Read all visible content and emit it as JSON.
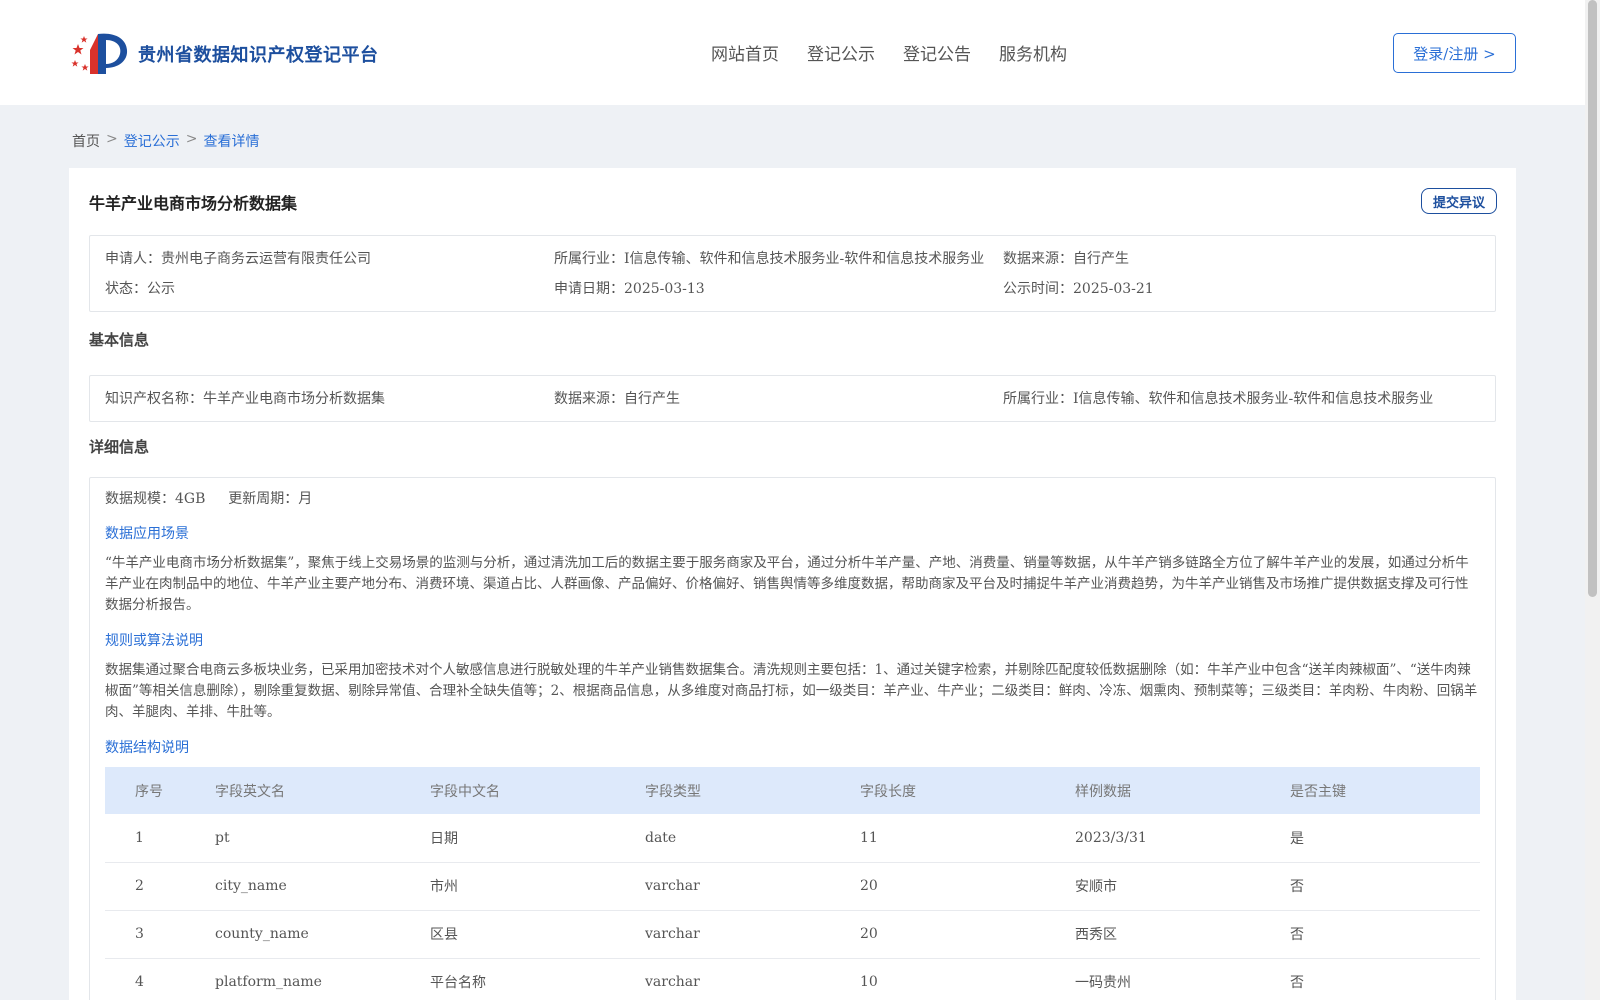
{
  "header": {
    "logo_text": "贵州省数据知识产权登记平台",
    "nav": [
      "网站首页",
      "登记公示",
      "登记公告",
      "服务机构"
    ],
    "login_label": "登录/注册 >"
  },
  "breadcrumb": {
    "home": "首页",
    "list": "登记公示",
    "current": "查看详情",
    "sep": ">"
  },
  "record": {
    "title": "牛羊产业电商市场分析数据集",
    "objection_label": "提交异议",
    "applicant_label": "申请人：",
    "applicant": "贵州电子商务云运营有限责任公司",
    "industry_label": "所属行业：",
    "industry": "I信息传输、软件和信息技术服务业-软件和信息技术服务业",
    "source_label": "数据来源：",
    "source": "自行产生",
    "status_label": "状态：",
    "status": "公示",
    "apply_date_label": "申请日期：",
    "apply_date": "2025-03-13",
    "publish_time_label": "公示时间：",
    "publish_time": "2025-03-21"
  },
  "basic": {
    "heading": "基本信息",
    "ip_name_label": "知识产权名称：",
    "ip_name": "牛羊产业电商市场分析数据集",
    "source_label": "数据来源：",
    "source": "自行产生",
    "industry_label": "所属行业：",
    "industry": "I信息传输、软件和信息技术服务业-软件和信息技术服务业"
  },
  "detail": {
    "heading": "详细信息",
    "scale_label": "数据规模：",
    "scale": "4GB",
    "cycle_label": "更新周期：",
    "cycle": "月",
    "scene_heading": "数据应用场景",
    "scene_text": "“牛羊产业电商市场分析数据集”，聚焦于线上交易场景的监测与分析，通过清洗加工后的数据主要于服务商家及平台，通过分析牛羊产量、产地、消费量、销量等数据，从牛羊产销多链路全方位了解牛羊产业的发展，如通过分析牛羊产业在肉制品中的地位、牛羊产业主要产地分布、消费环境、渠道占比、人群画像、产品偏好、价格偏好、销售舆情等多维度数据，帮助商家及平台及时捕捉牛羊产业消费趋势，为牛羊产业销售及市场推广提供数据支撑及可行性数据分析报告。",
    "rule_heading": "规则或算法说明",
    "rule_text": "数据集通过聚合电商云多板块业务，已采用加密技术对个人敏感信息进行脱敏处理的牛羊产业销售数据集合。清洗规则主要包括：1、通过关键字检索，并剔除匹配度较低数据删除（如：牛羊产业中包含“送羊肉辣椒面”、“送牛肉辣椒面”等相关信息删除），剔除重复数据、剔除异常值、合理补全缺失值等；2、根据商品信息，从多维度对商品打标，如一级类目：羊产业、牛产业；二级类目：鲜肉、冷冻、烟熏肉、预制菜等；三级类目：羊肉粉、牛肉粉、回锅羊肉、羊腿肉、羊排、牛肚等。",
    "structure_heading": "数据结构说明",
    "table": {
      "headers": [
        "序号",
        "字段英文名",
        "字段中文名",
        "字段类型",
        "字段长度",
        "样例数据",
        "是否主键"
      ],
      "rows": [
        [
          "1",
          "pt",
          "日期",
          "date",
          "11",
          "2023/3/31",
          "是"
        ],
        [
          "2",
          "city_name",
          "市州",
          "varchar",
          "20",
          "安顺市",
          "否"
        ],
        [
          "3",
          "county_name",
          "区县",
          "varchar",
          "20",
          "西秀区",
          "否"
        ],
        [
          "4",
          "platform_name",
          "平台名称",
          "varchar",
          "10",
          "一码贵州",
          "否"
        ]
      ]
    }
  }
}
